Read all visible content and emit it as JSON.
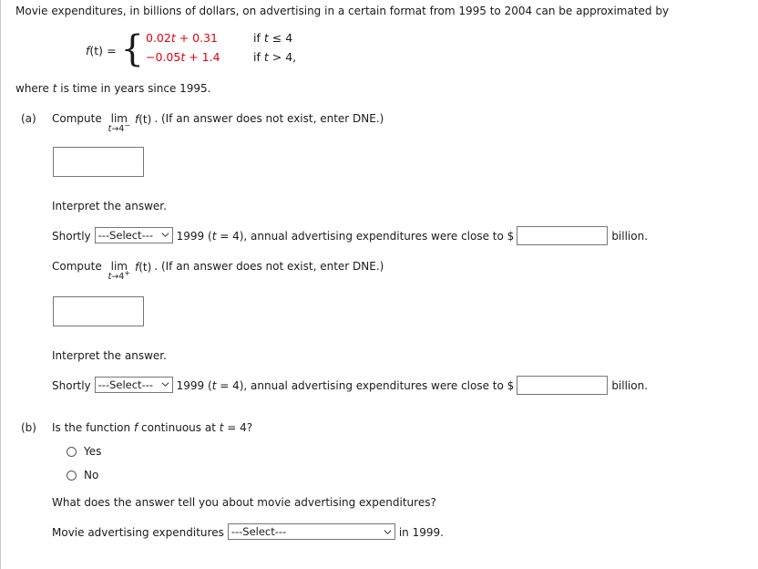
{
  "problem": {
    "intro": "Movie expenditures, in billions of dollars, on advertising in a certain format from 1995 to 2004 can be approximated by",
    "where_prefix": "where",
    "where_var": "t",
    "where_suffix": "is time in years since 1995."
  },
  "formula": {
    "function_name": "f",
    "function_arg": "(t)",
    "equals": "=",
    "brace": "{",
    "case1_expr_a": "0.02",
    "case1_expr_var": "t",
    "case1_expr_b": " + 0.31",
    "case1_cond_prefix": "if",
    "case1_cond_var": "t",
    "case1_cond_rest": "≤ 4",
    "case2_expr_a": "−0.05",
    "case2_expr_var": "t",
    "case2_expr_b": " + 1.4",
    "case2_cond_prefix": "if",
    "case2_cond_var": "t",
    "case2_cond_rest": "> 4,"
  },
  "part_a": {
    "label": "(a)",
    "compute_word": "Compute",
    "lim": "lim",
    "sub_var": "t",
    "sub_arrow": "→4",
    "sub_sign_minus": "−",
    "sub_sign_plus": "+",
    "fn": "f",
    "fn_arg": "(t)",
    "note": ". (If an answer does not exist, enter DNE.)",
    "answer_value": "",
    "answer_placeholder": "",
    "interpret_heading": "Interpret the answer.",
    "shortly_word": "Shortly",
    "select_value": "---Select---",
    "after_select": "1999 (",
    "t_var": "t",
    "after_t": " = 4), annual advertising expenditures were close to $",
    "billion_suffix": "billion.",
    "money_value": "",
    "money_placeholder": ""
  },
  "part_b": {
    "label": "(b)",
    "question_prefix": "Is the function",
    "fn": "f",
    "question_mid": "continuous at",
    "t_var": "t",
    "question_suffix": "= 4?",
    "options": [
      {
        "label": "Yes",
        "selected": false
      },
      {
        "label": "No",
        "selected": false
      }
    ],
    "follow_up": "What does the answer tell you about movie advertising expenditures?",
    "sentence_prefix": "Movie advertising expenditures",
    "select_value": "---Select---",
    "sentence_suffix": "in 1999."
  },
  "icons": {
    "chevron_down": "chevron-down-icon"
  },
  "colors": {
    "text": "#1a1a1a",
    "formula_red": "#e8000d",
    "field_border": "#767676",
    "page_border": "#c9c9c9",
    "background": "#ffffff"
  }
}
